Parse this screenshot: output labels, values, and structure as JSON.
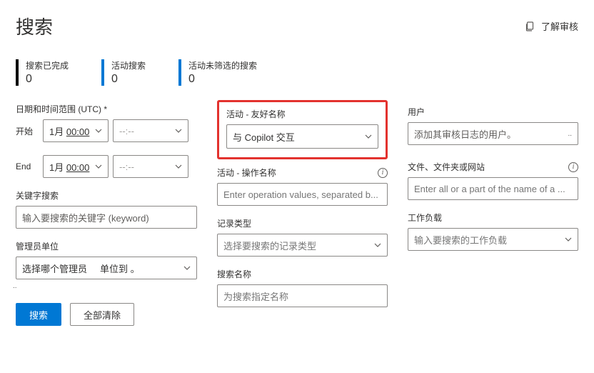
{
  "header": {
    "title": "搜索",
    "learn_label": "了解审核"
  },
  "stats": {
    "completed": {
      "label": "搜索已完成",
      "value": "0"
    },
    "active": {
      "label": "活动搜索",
      "value": "0"
    },
    "unfiltered": {
      "label": "活动未筛选的搜索",
      "value": "0"
    }
  },
  "left": {
    "daterange_label": "日期和时间范围 (UTC) *",
    "start_label": "开始",
    "end_label": "End",
    "date_value_1": "1月 00:00",
    "date_value_2": "1月 00:00",
    "time_placeholder": "--:--",
    "keyword_label": "关键字搜索",
    "keyword_placeholder": "输入要搜索的关键字 (keyword)",
    "admin_label": "管理员单位",
    "admin_text_a": "选择哪个管理员",
    "admin_text_b": "单位到 。"
  },
  "mid": {
    "friendly_label": "活动 - 友好名称",
    "friendly_value": "与 Copilot 交互",
    "opname_label": "活动 - 操作名称",
    "opname_placeholder": "Enter operation values, separated b...",
    "rectype_label": "记录类型",
    "rectype_placeholder": "选择要搜索的记录类型",
    "searchname_label": "搜索名称",
    "searchname_placeholder": "为搜索指定名称"
  },
  "right": {
    "user_label": "用户",
    "user_placeholder": "添加其审核日志的用户。",
    "file_label": "文件、文件夹或网站",
    "file_placeholder": "Enter all or a part of the name of a ...",
    "workload_label": "工作负载",
    "workload_placeholder": "输入要搜索的工作负载"
  },
  "buttons": {
    "search": "搜索",
    "clear": "全部清除"
  }
}
